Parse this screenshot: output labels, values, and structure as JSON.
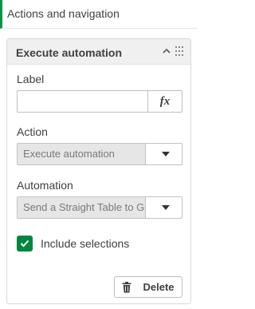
{
  "section": {
    "title": "Actions and navigation"
  },
  "panel": {
    "title": "Execute automation",
    "label_field": {
      "label": "Label",
      "value": "",
      "fx": "fx"
    },
    "action_field": {
      "label": "Action",
      "value": "Execute automation"
    },
    "automation_field": {
      "label": "Automation",
      "value": "Send a Straight Table to Goo"
    },
    "include_selections": {
      "label": "Include selections",
      "checked": true
    },
    "delete_label": "Delete"
  },
  "colors": {
    "accent": "#009845",
    "checkbox": "#00873d"
  },
  "icons": [
    "chevron-up-icon",
    "drag-handle-icon",
    "function-icon",
    "caret-down-icon",
    "checkmark-icon",
    "trash-icon"
  ]
}
